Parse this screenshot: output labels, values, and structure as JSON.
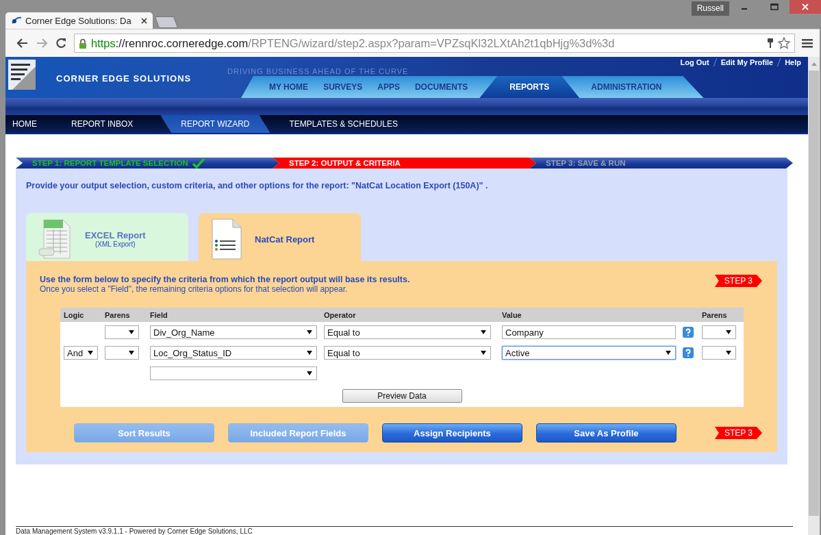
{
  "browser": {
    "tab_title": "Corner Edge Solutions: Da",
    "user": "Russell",
    "url": {
      "scheme": "https",
      "host": "://rennroc.corneredge.com",
      "path": "/RPTENG/wizard/step2.aspx?param=VPZsqKl32LXtAh2t1qbHjg%3d%3d"
    }
  },
  "header": {
    "brand": "CORNER EDGE SOLUTIONS",
    "tagline": "DRIVING BUSINESS AHEAD OF THE CURVE",
    "top_links": [
      "Log Out",
      "Edit My Profile",
      "Help"
    ],
    "main_nav": [
      {
        "label": "MY HOME",
        "selected": false
      },
      {
        "label": "SURVEYS",
        "selected": false
      },
      {
        "label": "APPS",
        "selected": false
      },
      {
        "label": "DOCUMENTS",
        "selected": false
      },
      {
        "label": "REPORTS",
        "selected": true
      },
      {
        "label": "ADMINISTRATION",
        "selected": false
      }
    ],
    "sub_nav": [
      {
        "label": "HOME",
        "selected": false
      },
      {
        "label": "REPORT INBOX",
        "selected": false
      },
      {
        "label": "REPORT WIZARD",
        "selected": true
      },
      {
        "label": "TEMPLATES & SCHEDULES",
        "selected": false
      }
    ]
  },
  "steps": [
    {
      "label": "STEP 1: REPORT TEMPLATE SELECTION",
      "completed": true,
      "selected": false
    },
    {
      "label": "STEP 2: OUTPUT & CRITERIA",
      "completed": false,
      "selected": true
    },
    {
      "label": "STEP 3: SAVE & RUN",
      "completed": false,
      "selected": false
    }
  ],
  "intro": "Provide your output selection, custom criteria, and other options for the report: \"NatCat Location Export (150A)\" .",
  "output_tabs": [
    {
      "kind": "excel",
      "title": "EXCEL Report",
      "subtitle": "(XML Export)",
      "selected": false
    },
    {
      "kind": "list",
      "title": "NatCat Report",
      "selected": true
    }
  ],
  "instructions": {
    "heading": "Use the form below to specify the criteria from which the report output will base its results.",
    "note": "Once you select a \"Field\", the remaining criteria options for that selection will appear."
  },
  "step_badges": [
    "STEP 3",
    "STEP 3"
  ],
  "criteria": {
    "columns": [
      "Logic",
      "Parens",
      "Field",
      "Operator",
      "Value",
      "Parens"
    ],
    "rows": [
      {
        "kind": "condition",
        "field": "Div_Org_Name",
        "operator": "Equal to",
        "value": "Company",
        "dropdown": false,
        "focused": false
      },
      {
        "kind": "condition",
        "logic": "And",
        "field": "Loc_Org_Status_ID",
        "operator": "Equal to",
        "value": "Active",
        "dropdown": true,
        "focused": true
      },
      {
        "kind": "new"
      }
    ],
    "preview_button": "Preview Data"
  },
  "actions": [
    {
      "label": "Sort Results",
      "disabled": true
    },
    {
      "label": "Included Report Fields",
      "disabled": true
    },
    {
      "label": "Assign Recipients",
      "disabled": false
    },
    {
      "label": "Save As Profile",
      "disabled": false
    }
  ],
  "footer": "Data Management System v3.9.1.1 - Powered by Corner Edge Solutions, LLC"
}
